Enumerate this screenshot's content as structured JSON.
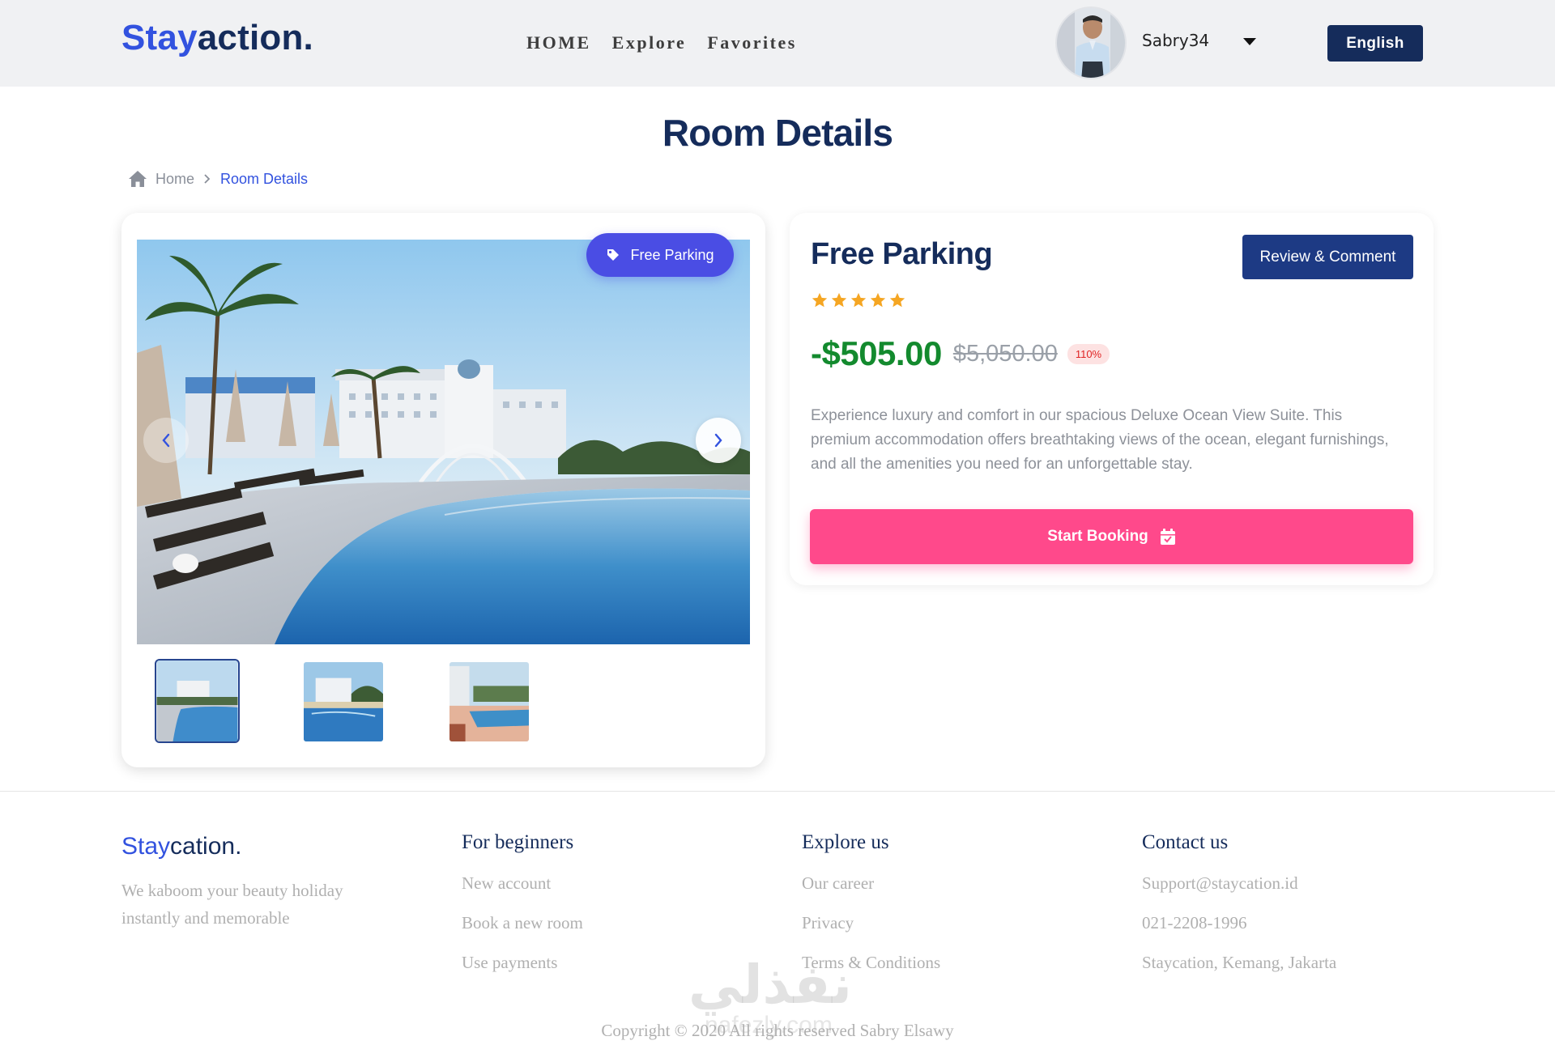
{
  "header": {
    "brand_part1": "Stay",
    "brand_part2": "action.",
    "nav": [
      "HOME",
      "Explore",
      "Favorites"
    ],
    "username": "Sabry34",
    "language": "English"
  },
  "page": {
    "title": "Room Details",
    "breadcrumb": {
      "home": "Home",
      "current": "Room Details"
    }
  },
  "gallery": {
    "badge": "Free Parking",
    "thumbnail_count": 3,
    "active_thumbnail": 1
  },
  "room": {
    "title": "Free Parking",
    "review_button": "Review & Comment",
    "rating": 5,
    "price": "-$505.00",
    "old_price": "$5,050.00",
    "discount": "110%",
    "description": "Experience luxury and comfort in our spacious Deluxe Ocean View Suite. This premium accommodation offers breathtaking views of the ocean, elegant furnishings, and all the amenities you need for an unforgettable stay.",
    "book_button": "Start Booking"
  },
  "footer": {
    "brand_part1": "Stay",
    "brand_part2": "cation.",
    "tagline": "We kaboom your beauty holiday instantly and memorable",
    "columns": [
      {
        "title": "For beginners",
        "links": [
          "New account",
          "Book a new room",
          "Use payments"
        ]
      },
      {
        "title": "Explore us",
        "links": [
          "Our career",
          "Privacy",
          "Terms & Conditions"
        ]
      },
      {
        "title": "Contact us",
        "links": [
          "Support@staycation.id",
          "021-2208-1996",
          "Staycation, Kemang, Jakarta"
        ]
      }
    ],
    "copyright": "Copyright © 2020 All rights reserved Sabry Elsawy"
  },
  "watermark": {
    "arabic": "نفذلي",
    "latin": "nafezly.com"
  },
  "colors": {
    "primary": "#152c5b",
    "accent_blue": "#3252df",
    "badge": "#4a4de4",
    "price_green": "#138a2e",
    "book_pink": "#ff498b",
    "star": "#f5a623"
  }
}
